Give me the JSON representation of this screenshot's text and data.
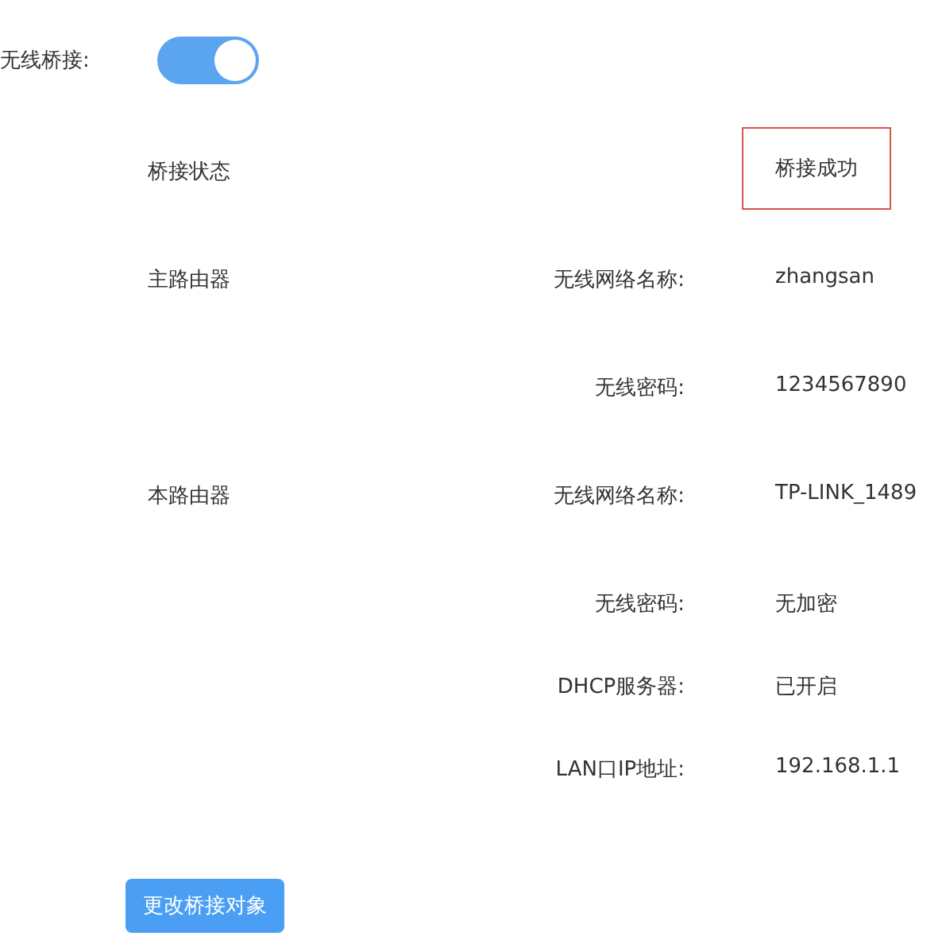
{
  "bridge_toggle": {
    "label": "无线桥接:",
    "on": true
  },
  "status": {
    "label": "桥接状态",
    "value": "桥接成功"
  },
  "sections": [
    {
      "label": "主路由器",
      "fields": [
        {
          "key": "无线网络名称:",
          "value": "zhangsan"
        },
        {
          "key": "无线密码:",
          "value": "1234567890"
        }
      ]
    },
    {
      "label": "本路由器",
      "fields": [
        {
          "key": "无线网络名称:",
          "value": "TP-LINK_1489"
        },
        {
          "key": "无线密码:",
          "value": "无加密"
        },
        {
          "key": "DHCP服务器:",
          "value": "已开启"
        },
        {
          "key": "LAN口IP地址:",
          "value": "192.168.1.1"
        }
      ]
    }
  ],
  "button": "更改桥接对象"
}
